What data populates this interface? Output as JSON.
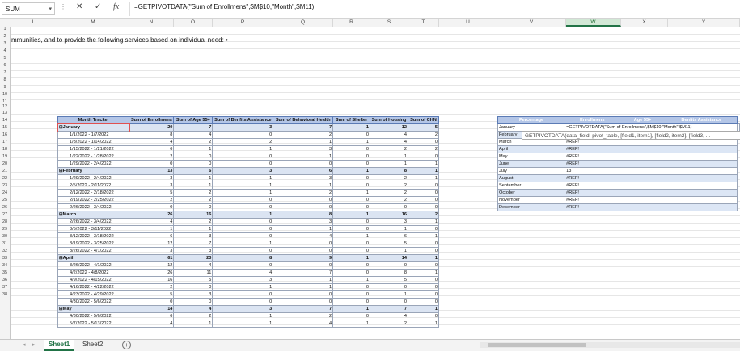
{
  "formula_bar": {
    "name_box": "SUM",
    "cancel_icon": "✕",
    "enter_icon": "✓",
    "fx_label": "fx",
    "formula": "=GETPIVOTDATA(\"Sum of Enrollmens\",$M$10,\"Month\",$M11)"
  },
  "columns": [
    "L",
    "M",
    "N",
    "O",
    "P",
    "Q",
    "R",
    "S",
    "T",
    "U",
    "V",
    "W",
    "X",
    "Y"
  ],
  "rows": [
    "1",
    "2",
    "3",
    "4",
    "5",
    "6",
    "7",
    "8",
    "9",
    "10",
    "11",
    "12",
    "13",
    "14",
    "15",
    "16",
    "17",
    "18",
    "19",
    "20",
    "21",
    "22",
    "23",
    "24",
    "25",
    "26",
    "27",
    "28",
    "29",
    "30",
    "31",
    "32",
    "33",
    "34",
    "35",
    "36",
    "37",
    "38"
  ],
  "row2_text": "mmunities, and to provide the following services based on individual need: •",
  "pivot": {
    "headers": [
      "Month Tracker",
      "Sum of Enrollmens",
      "Sum of Age 55+",
      "Sum of Benfits Assistance",
      "Sum of Behavioral Health",
      "Sum of Shelter",
      "Sum of Housing",
      "Sum of CHN"
    ],
    "rows": [
      {
        "label": "⊟January",
        "values": [
          "20",
          "7",
          "3",
          "7",
          "1",
          "12",
          "5"
        ],
        "group": true
      },
      {
        "label": "1/1/2022 - 1/7/2022",
        "values": [
          "8",
          "4",
          "0",
          "2",
          "0",
          "4",
          "2"
        ]
      },
      {
        "label": "1/8/2022 - 1/14/2022",
        "values": [
          "4",
          "2",
          "2",
          "1",
          "1",
          "4",
          "0"
        ]
      },
      {
        "label": "1/15/2022 - 1/21/2022",
        "values": [
          "6",
          "1",
          "1",
          "3",
          "0",
          "2",
          "2"
        ]
      },
      {
        "label": "1/22/2022 - 1/28/2022",
        "values": [
          "2",
          "0",
          "0",
          "1",
          "0",
          "1",
          "0"
        ]
      },
      {
        "label": "1/29/2022 - 2/4/2022",
        "values": [
          "0",
          "0",
          "0",
          "0",
          "0",
          "1",
          "1"
        ]
      },
      {
        "label": "⊟February",
        "values": [
          "13",
          "6",
          "3",
          "6",
          "1",
          "8",
          "1"
        ],
        "group": true
      },
      {
        "label": "1/29/2022 - 2/4/2022",
        "values": [
          "3",
          "1",
          "1",
          "3",
          "0",
          "2",
          "1"
        ]
      },
      {
        "label": "2/5/2022 - 2/11/2022",
        "values": [
          "3",
          "1",
          "1",
          "1",
          "0",
          "2",
          "0"
        ]
      },
      {
        "label": "2/12/2022 - 2/18/2022",
        "values": [
          "5",
          "2",
          "1",
          "2",
          "1",
          "2",
          "0"
        ]
      },
      {
        "label": "2/19/2022 - 2/25/2022",
        "values": [
          "2",
          "2",
          "0",
          "0",
          "0",
          "2",
          "0"
        ]
      },
      {
        "label": "2/26/2022 - 3/4/2022",
        "values": [
          "0",
          "0",
          "0",
          "0",
          "0",
          "0",
          "0"
        ]
      },
      {
        "label": "⊟March",
        "values": [
          "26",
          "16",
          "1",
          "8",
          "1",
          "16",
          "2"
        ],
        "group": true
      },
      {
        "label": "2/26/2022 - 3/4/2022",
        "values": [
          "4",
          "2",
          "0",
          "3",
          "0",
          "3",
          "1"
        ]
      },
      {
        "label": "3/5/2022 - 3/11/2022",
        "values": [
          "1",
          "1",
          "0",
          "1",
          "0",
          "1",
          "0"
        ]
      },
      {
        "label": "3/12/2022 - 3/18/2022",
        "values": [
          "6",
          "3",
          "0",
          "4",
          "1",
          "6",
          "1"
        ]
      },
      {
        "label": "3/19/2022 - 3/25/2022",
        "values": [
          "12",
          "7",
          "1",
          "0",
          "0",
          "5",
          "0"
        ]
      },
      {
        "label": "3/26/2022 - 4/1/2022",
        "values": [
          "3",
          "3",
          "0",
          "0",
          "0",
          "1",
          "0"
        ]
      },
      {
        "label": "⊟April",
        "values": [
          "61",
          "23",
          "8",
          "9",
          "1",
          "14",
          "1"
        ],
        "group": true
      },
      {
        "label": "3/26/2022 - 4/1/2022",
        "values": [
          "12",
          "4",
          "0",
          "0",
          "0",
          "0",
          "0"
        ]
      },
      {
        "label": "4/2/2022 - 4/8/2022",
        "values": [
          "26",
          "11",
          "4",
          "7",
          "0",
          "8",
          "1"
        ]
      },
      {
        "label": "4/9/2022 - 4/15/2022",
        "values": [
          "16",
          "5",
          "3",
          "1",
          "1",
          "5",
          "0"
        ]
      },
      {
        "label": "4/16/2022 - 4/22/2022",
        "values": [
          "2",
          "0",
          "1",
          "1",
          "0",
          "0",
          "0"
        ]
      },
      {
        "label": "4/23/2022 - 4/29/2022",
        "values": [
          "5",
          "3",
          "0",
          "0",
          "0",
          "1",
          "0"
        ]
      },
      {
        "label": "4/30/2022 - 5/6/2022",
        "values": [
          "0",
          "0",
          "0",
          "0",
          "0",
          "0",
          "0"
        ]
      },
      {
        "label": "⊟May",
        "values": [
          "14",
          "4",
          "3",
          "7",
          "1",
          "7",
          "1"
        ],
        "group": true
      },
      {
        "label": "4/30/2022 - 5/6/2022",
        "values": [
          "6",
          "2",
          "1",
          "2",
          "0",
          "4",
          "0"
        ]
      },
      {
        "label": "5/7/2022 - 5/13/2022",
        "values": [
          "4",
          "1",
          "1",
          "4",
          "1",
          "2",
          "1"
        ]
      }
    ]
  },
  "summary": {
    "headers": [
      "Percentage",
      "Enrollmens",
      "Age 55+",
      "Benfits Assistance"
    ],
    "rows": [
      {
        "label": "January",
        "value": "=GETPIVOTDATA(\"Sum of Enrollmens\",$M$10,\"Month\",$M11)"
      },
      {
        "label": "February",
        "value": ""
      },
      {
        "label": "March",
        "value": "#REF!"
      },
      {
        "label": "April",
        "value": "#REF!"
      },
      {
        "label": "May",
        "value": "#REF!"
      },
      {
        "label": "June",
        "value": "#REF!"
      },
      {
        "label": "July",
        "value": "13"
      },
      {
        "label": "August",
        "value": "#REF!"
      },
      {
        "label": "September",
        "value": "#REF!"
      },
      {
        "label": "October",
        "value": "#REF!"
      },
      {
        "label": "November",
        "value": "#REF!"
      },
      {
        "label": "December",
        "value": "#REF!"
      }
    ],
    "tooltip": "GETPIVOTDATA(data_field, pivot_table, [field1, item1], [field2, item2], [field3, ..."
  },
  "sheet_tabs": [
    "Sheet1",
    "Sheet2"
  ],
  "active_tab": "Sheet1",
  "add_sheet": "+",
  "colors": {
    "accent": "#217346",
    "pivot_header": "#b4c6e7",
    "summary_header": "#8ea9db"
  }
}
